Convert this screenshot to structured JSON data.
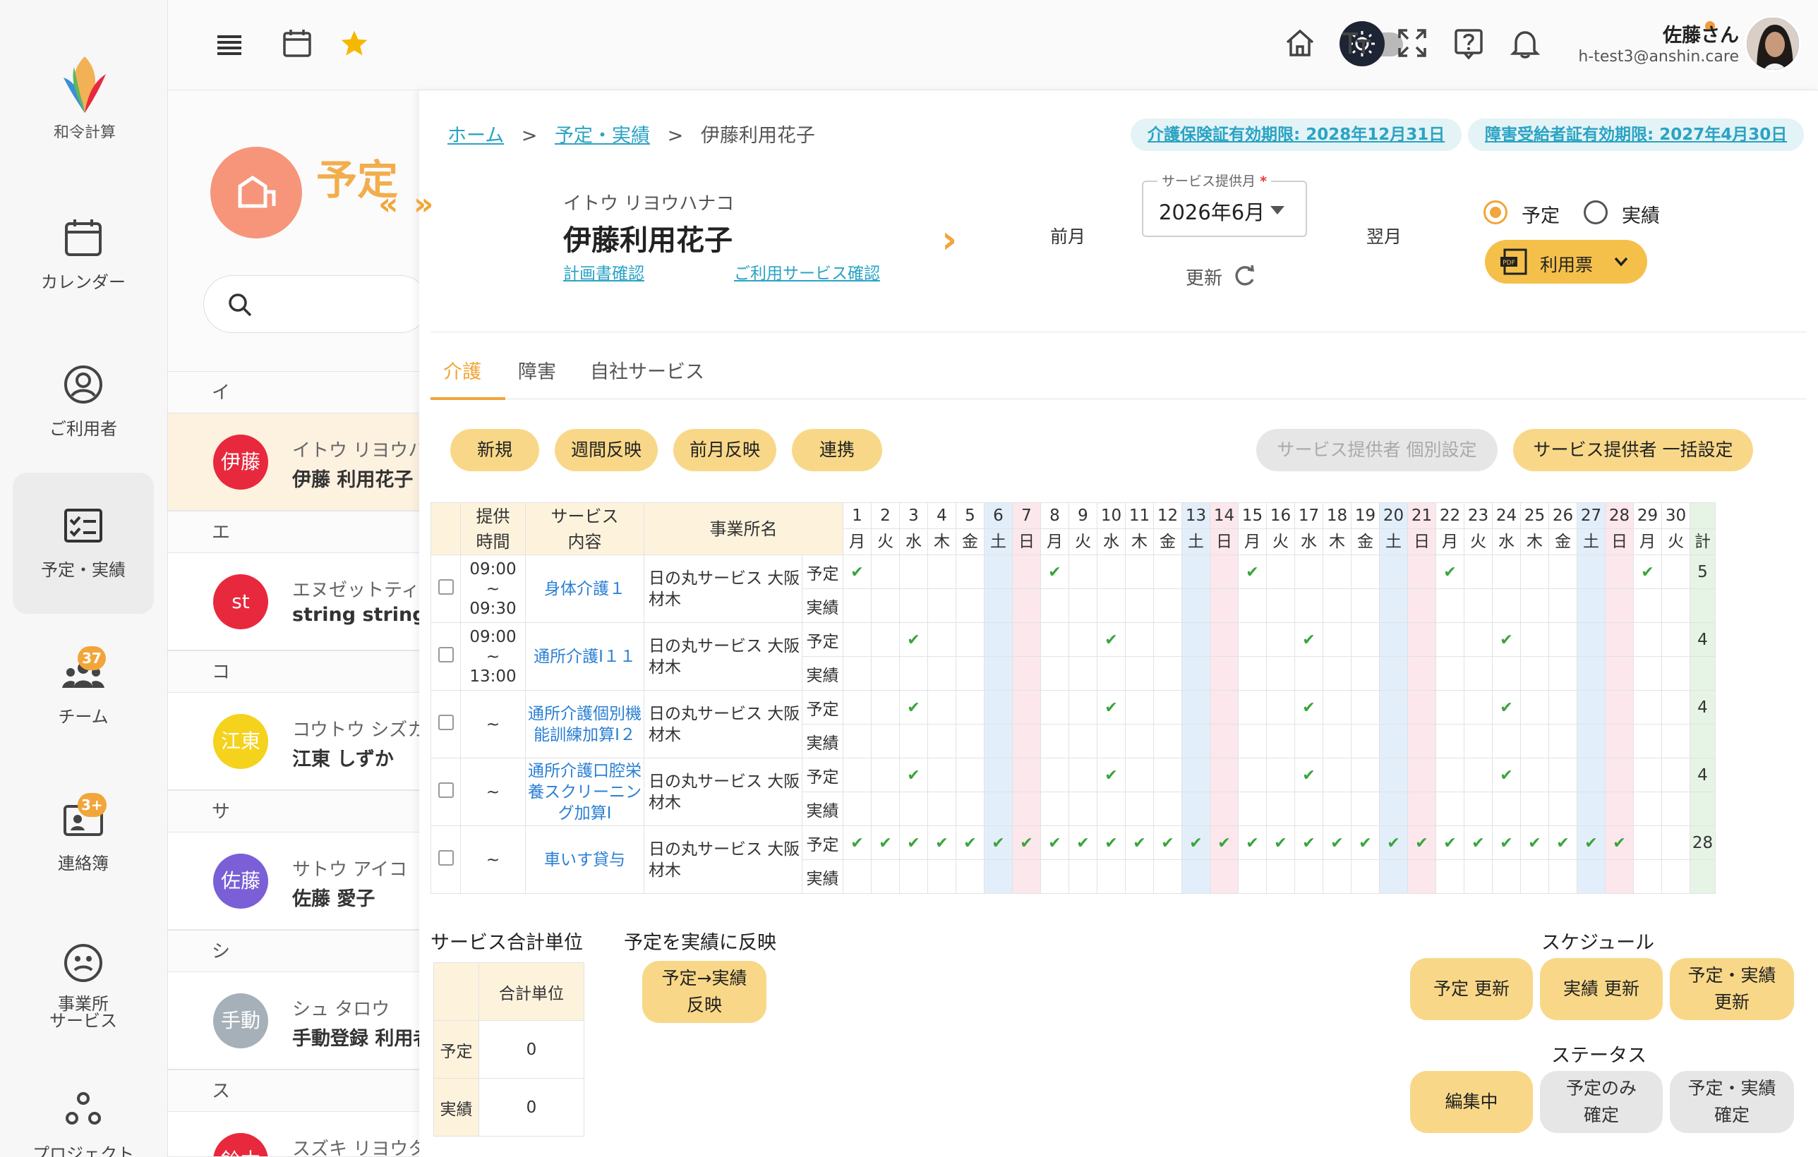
{
  "sidebar": {
    "logo_text": "和令計算",
    "items": [
      {
        "label": "カレンダー",
        "icon": "calendar-icon"
      },
      {
        "label": "ご利用者",
        "icon": "user-circle-icon"
      },
      {
        "label": "予定・実績",
        "icon": "checklist-icon"
      },
      {
        "label": "チーム",
        "icon": "team-icon",
        "badge": "37"
      },
      {
        "label": "連絡簿",
        "icon": "contact-book-icon",
        "badge": "3+"
      },
      {
        "label": "事業所サービス",
        "label2": "サービス",
        "label1": "事業所",
        "icon": "office-service-icon"
      },
      {
        "label": "プロジェクト",
        "icon": "project-icon"
      }
    ]
  },
  "topbar": {
    "user_name": "佐藤さん",
    "user_email": "h-test3@anshin.care"
  },
  "left_panel": {
    "hero_text": "予定",
    "groups": [
      {
        "head": "イ",
        "rows": [
          {
            "avatar": "伊藤",
            "color": "#e8283c",
            "kana": "イトウ リヨウハナコ",
            "name": "伊藤 利用花子",
            "selected": true
          }
        ]
      },
      {
        "head": "エ",
        "rows": [
          {
            "avatar": "st",
            "color": "#e8283c",
            "kana": "エヌゼットティ",
            "name": "string string"
          }
        ]
      },
      {
        "head": "コ",
        "rows": [
          {
            "avatar": "江東",
            "color": "#f5d21c",
            "kana": "コウトウ シズカ",
            "name": "江東 しずか"
          }
        ]
      },
      {
        "head": "サ",
        "rows": [
          {
            "avatar": "佐藤",
            "color": "#7a5fd6",
            "kana": "サトウ アイコ",
            "name": "佐藤 愛子"
          }
        ]
      },
      {
        "head": "シ",
        "rows": [
          {
            "avatar": "手動",
            "color": "#a5b0b8",
            "kana": "シュ タロウ",
            "name": "手動登録 利用者"
          }
        ]
      },
      {
        "head": "ス",
        "rows": [
          {
            "avatar": "鈴木",
            "color": "#e8283c",
            "kana": "スズキ リヨウタ",
            "name": ""
          }
        ]
      }
    ]
  },
  "breadcrumb": {
    "home": "ホーム",
    "sep": ">",
    "schedule": "予定・実績",
    "current": "伊藤利用花子"
  },
  "pills": {
    "insurance": "介護保険証有効期限: 2028年12月31日",
    "disability": "障害受給者証有効期限: 2027年4月30日"
  },
  "client": {
    "kana": "イトウ リヨウハナコ",
    "name": "伊藤利用花子",
    "link_plan": "計画書確認",
    "link_service": "ご利用サービス確認"
  },
  "month": {
    "prev": "前月",
    "next": "翌月",
    "label": "サービス提供月",
    "required": "*",
    "value": "2026年6月",
    "refresh": "更新"
  },
  "mode": {
    "plan": "予定",
    "actual": "実績",
    "pdf_button": "利用票"
  },
  "tabs": [
    "介護",
    "障害",
    "自社サービス"
  ],
  "actions": {
    "new": "新規",
    "weekly": "週間反映",
    "prev_month": "前月反映",
    "link": "連携",
    "provider_individual": "サービス提供者 個別設定",
    "provider_bulk": "サービス提供者 一括設定"
  },
  "table": {
    "headers": {
      "time": "提供\n時間",
      "time1": "提供",
      "time2": "時間",
      "service1": "サービス",
      "service2": "内容",
      "office": "事業所名",
      "total": "計"
    },
    "days": [
      {
        "d": "1",
        "w": "月"
      },
      {
        "d": "2",
        "w": "火"
      },
      {
        "d": "3",
        "w": "水"
      },
      {
        "d": "4",
        "w": "木"
      },
      {
        "d": "5",
        "w": "金"
      },
      {
        "d": "6",
        "w": "土"
      },
      {
        "d": "7",
        "w": "日"
      },
      {
        "d": "8",
        "w": "月"
      },
      {
        "d": "9",
        "w": "火"
      },
      {
        "d": "10",
        "w": "水"
      },
      {
        "d": "11",
        "w": "木"
      },
      {
        "d": "12",
        "w": "金"
      },
      {
        "d": "13",
        "w": "土"
      },
      {
        "d": "14",
        "w": "日"
      },
      {
        "d": "15",
        "w": "月"
      },
      {
        "d": "16",
        "w": "火"
      },
      {
        "d": "17",
        "w": "水"
      },
      {
        "d": "18",
        "w": "木"
      },
      {
        "d": "19",
        "w": "金"
      },
      {
        "d": "20",
        "w": "土"
      },
      {
        "d": "21",
        "w": "日"
      },
      {
        "d": "22",
        "w": "月"
      },
      {
        "d": "23",
        "w": "火"
      },
      {
        "d": "24",
        "w": "水"
      },
      {
        "d": "25",
        "w": "木"
      },
      {
        "d": "26",
        "w": "金"
      },
      {
        "d": "27",
        "w": "土"
      },
      {
        "d": "28",
        "w": "日"
      },
      {
        "d": "29",
        "w": "月"
      },
      {
        "d": "30",
        "w": "火"
      }
    ],
    "plan_label": "予定",
    "actual_label": "実績",
    "rows": [
      {
        "time1": "09:00",
        "time_sep": "~",
        "time2": "09:30",
        "service": "身体介護１",
        "office": "日の丸サービス 大阪材木",
        "plan_days": [
          1,
          8,
          15,
          22,
          29
        ],
        "total": "5"
      },
      {
        "time1": "09:00",
        "time_sep": "~",
        "time2": "13:00",
        "service": "通所介護Ⅰ１１",
        "office": "日の丸サービス 大阪材木",
        "plan_days": [
          3,
          10,
          17,
          24
        ],
        "total": "4"
      },
      {
        "time1": "",
        "time_sep": "~",
        "time2": "",
        "service": "通所介護個別機能訓練加算Ⅰ２",
        "office": "日の丸サービス 大阪材木",
        "plan_days": [
          3,
          10,
          17,
          24
        ],
        "total": "4"
      },
      {
        "time1": "",
        "time_sep": "~",
        "time2": "",
        "service": "通所介護口腔栄養スクリーニング加算Ⅰ",
        "office": "日の丸サービス 大阪材木",
        "plan_days": [
          3,
          10,
          17,
          24
        ],
        "total": "4"
      },
      {
        "time1": "",
        "time_sep": "~",
        "time2": "",
        "service": "車いす貸与",
        "office": "日の丸サービス 大阪材木",
        "plan_days": [
          1,
          2,
          3,
          4,
          5,
          6,
          7,
          8,
          9,
          10,
          11,
          12,
          13,
          14,
          15,
          16,
          17,
          18,
          19,
          20,
          21,
          22,
          23,
          24,
          25,
          26,
          27,
          28
        ],
        "total": "28"
      }
    ]
  },
  "summary": {
    "title": "サービス合計単位",
    "col": "合計単位",
    "plan": "予定",
    "plan_value": "0",
    "actual": "実績",
    "actual_value": "0"
  },
  "reflect": {
    "title": "予定を実績に反映",
    "button_line1": "予定→実績",
    "button_line2": "反映"
  },
  "schedule": {
    "title": "スケジュール",
    "plan_update": "予定 更新",
    "actual_update": "実績 更新",
    "both_update_1": "予定・実績",
    "both_update_2": "更新"
  },
  "status": {
    "title": "ステータス",
    "editing": "編集中",
    "plan_only_1": "予定のみ",
    "plan_only_2": "確定",
    "both_1": "予定・実績",
    "both_2": "確定"
  },
  "colors": {
    "accent": "#f2a53a",
    "button": "#f8d888",
    "link": "#2aa3c4",
    "check": "#3aa53a"
  }
}
